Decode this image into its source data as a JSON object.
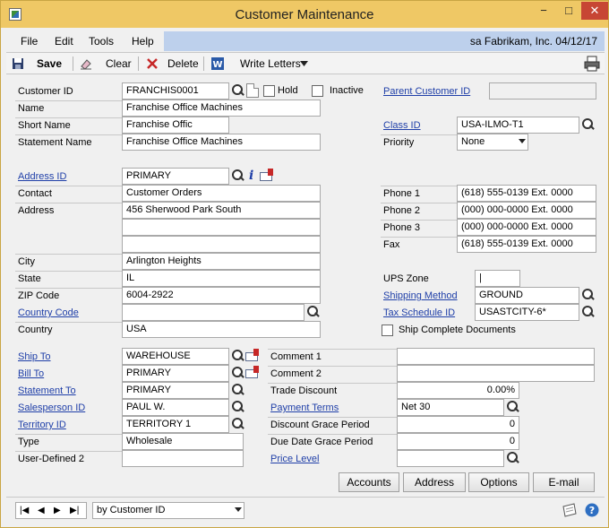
{
  "window": {
    "title": "Customer Maintenance",
    "controls": {
      "minimize": "−",
      "maximize": "□",
      "close": "✕"
    }
  },
  "menu": {
    "items": [
      "File",
      "Edit",
      "Tools",
      "Help"
    ],
    "company_line": "sa  Fabrikam, Inc.  04/12/17"
  },
  "toolbar": {
    "save": "Save",
    "clear": "Clear",
    "delete": "Delete",
    "write_letters": "Write Letters"
  },
  "form": {
    "customer_id": {
      "label": "Customer ID",
      "value": "FRANCHIS0001"
    },
    "hold": {
      "label": "Hold",
      "checked": false
    },
    "inactive": {
      "label": "Inactive",
      "checked": false
    },
    "parent_customer_id": {
      "label": "Parent Customer ID",
      "value": ""
    },
    "name": {
      "label": "Name",
      "value": "Franchise Office Machines"
    },
    "short_name": {
      "label": "Short Name",
      "value": "Franchise Offic"
    },
    "statement_name": {
      "label": "Statement Name",
      "value": "Franchise Office Machines"
    },
    "class_id": {
      "label": "Class ID",
      "value": "USA-ILMO-T1"
    },
    "priority": {
      "label": "Priority",
      "value": "None"
    },
    "address_id": {
      "label": "Address ID",
      "value": "PRIMARY"
    },
    "contact": {
      "label": "Contact",
      "value": "Customer Orders"
    },
    "address": {
      "label": "Address",
      "line1": "456 Sherwood Park South",
      "line2": "",
      "line3": ""
    },
    "city": {
      "label": "City",
      "value": "Arlington Heights"
    },
    "state": {
      "label": "State",
      "value": "IL"
    },
    "zip": {
      "label": "ZIP Code",
      "value": "6004-2922"
    },
    "country_code": {
      "label": "Country Code",
      "value": ""
    },
    "country": {
      "label": "Country",
      "value": "USA"
    },
    "phone1": {
      "label": "Phone 1",
      "value": "(618) 555-0139  Ext. 0000"
    },
    "phone2": {
      "label": "Phone 2",
      "value": "(000) 000-0000  Ext. 0000"
    },
    "phone3": {
      "label": "Phone 3",
      "value": "(000) 000-0000  Ext. 0000"
    },
    "fax": {
      "label": "Fax",
      "value": "(618) 555-0139  Ext. 0000"
    },
    "ups_zone": {
      "label": "UPS Zone",
      "value": "|"
    },
    "shipping_method": {
      "label": "Shipping Method",
      "value": "GROUND"
    },
    "tax_schedule_id": {
      "label": "Tax Schedule ID",
      "value": "USASTCITY-6*"
    },
    "ship_complete": {
      "label": "Ship Complete Documents",
      "checked": false
    },
    "ship_to": {
      "label": "Ship To",
      "value": "WAREHOUSE"
    },
    "bill_to": {
      "label": "Bill To",
      "value": "PRIMARY"
    },
    "statement_to": {
      "label": "Statement To",
      "value": "PRIMARY"
    },
    "salesperson_id": {
      "label": "Salesperson ID",
      "value": "PAUL W."
    },
    "territory_id": {
      "label": "Territory ID",
      "value": "TERRITORY 1"
    },
    "type": {
      "label": "Type",
      "value": "Wholesale"
    },
    "user_defined_2": {
      "label": "User-Defined 2",
      "value": ""
    },
    "comment1": {
      "label": "Comment 1",
      "value": ""
    },
    "comment2": {
      "label": "Comment 2",
      "value": ""
    },
    "trade_discount": {
      "label": "Trade Discount",
      "value": "0.00%"
    },
    "payment_terms": {
      "label": "Payment Terms",
      "value": "Net 30"
    },
    "discount_grace": {
      "label": "Discount Grace Period",
      "value": "0"
    },
    "due_date_grace": {
      "label": "Due Date Grace Period",
      "value": "0"
    },
    "price_level": {
      "label": "Price Level",
      "value": ""
    }
  },
  "buttons": {
    "accounts": "Accounts",
    "address": "Address",
    "options": "Options",
    "email": "E-mail"
  },
  "status": {
    "sort_by": "by Customer ID"
  },
  "colors": {
    "title_bar": "#efc865",
    "link": "#1f3fa8",
    "company_panel": "#bdd0ec"
  }
}
